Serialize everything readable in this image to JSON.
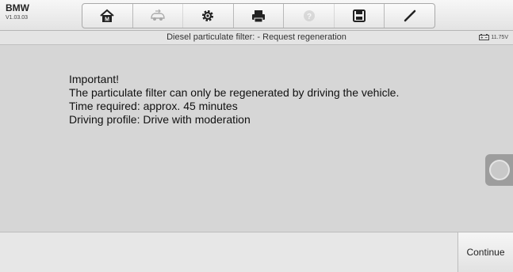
{
  "header": {
    "make": "BMW",
    "version": "V1.03.03"
  },
  "toolbar": {
    "tools": [
      {
        "name": "home-icon"
      },
      {
        "name": "vehicle-swap-icon",
        "disabled": true
      },
      {
        "name": "settings-icon"
      },
      {
        "name": "print-icon"
      },
      {
        "name": "help-icon",
        "disabled": true
      },
      {
        "name": "save-icon"
      },
      {
        "name": "edit-pen-icon"
      }
    ]
  },
  "subbar": {
    "title": "Diesel particulate filter: - Request regeneration",
    "battery_voltage": "11.75V"
  },
  "message": {
    "line1": "Important!",
    "line2": "The particulate filter can only be regenerated by driving the vehicle.",
    "line3": "Time required: approx. 45 minutes",
    "line4": "Driving profile: Drive with moderation"
  },
  "footer": {
    "continue_label": "Continue"
  }
}
